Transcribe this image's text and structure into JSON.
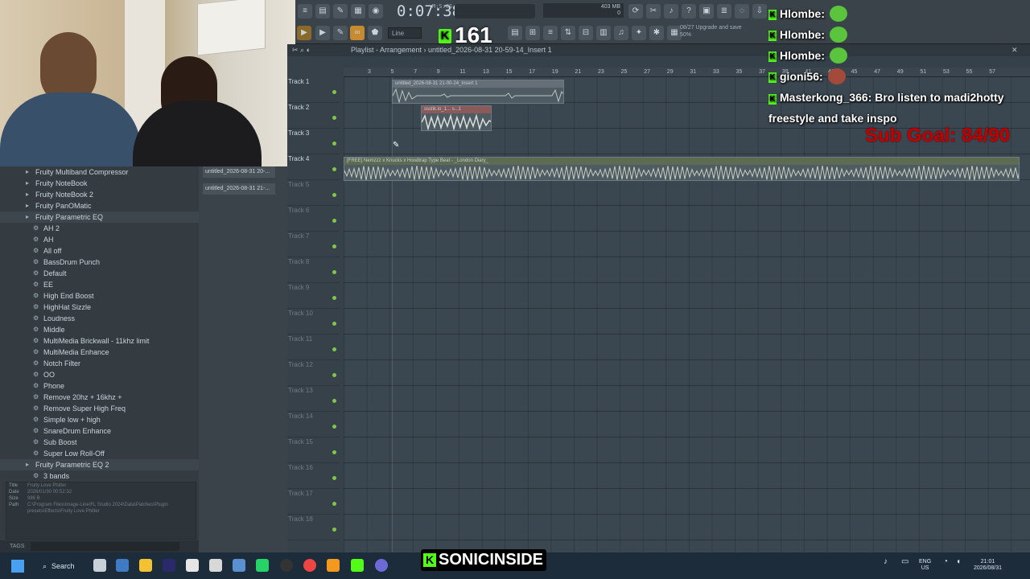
{
  "toolbar": {
    "time": "0:07:38",
    "time_unit": "M:S:CS",
    "memory": "403 MB",
    "memory_sub": "0",
    "snap": "Line",
    "pattern_label": "Pa",
    "upgrade_1": "08/27  Upgrade and save",
    "upgrade_2": "50%"
  },
  "kick_count": "161",
  "kick_k": "K",
  "browser": {
    "items": [
      {
        "type": "folder",
        "label": "Fruity Multiband Compressor"
      },
      {
        "type": "folder",
        "label": "Fruity NoteBook"
      },
      {
        "type": "folder",
        "label": "Fruity NoteBook 2"
      },
      {
        "type": "folder",
        "label": "Fruity PanOMatic"
      },
      {
        "type": "folder",
        "label": "Fruity Parametric EQ",
        "selected": true
      },
      {
        "type": "preset",
        "label": "AH 2"
      },
      {
        "type": "preset",
        "label": "AH"
      },
      {
        "type": "preset",
        "label": "All off"
      },
      {
        "type": "preset",
        "label": "BassDrum Punch"
      },
      {
        "type": "preset",
        "label": "Default"
      },
      {
        "type": "preset",
        "label": "EE"
      },
      {
        "type": "preset",
        "label": "High End Boost"
      },
      {
        "type": "preset",
        "label": "HighHat Sizzle"
      },
      {
        "type": "preset",
        "label": "Loudness"
      },
      {
        "type": "preset",
        "label": "Middle"
      },
      {
        "type": "preset",
        "label": "MultiMedia Brickwall - 11khz limit"
      },
      {
        "type": "preset",
        "label": "MultiMedia Enhance"
      },
      {
        "type": "preset",
        "label": "Notch Filter"
      },
      {
        "type": "preset",
        "label": "OO"
      },
      {
        "type": "preset",
        "label": "Phone"
      },
      {
        "type": "preset",
        "label": "Remove 20hz + 16khz +"
      },
      {
        "type": "preset",
        "label": "Remove Super High Freq"
      },
      {
        "type": "preset",
        "label": "Simple low + high"
      },
      {
        "type": "preset",
        "label": "SnareDrum Enhance"
      },
      {
        "type": "preset",
        "label": "Sub Boost"
      },
      {
        "type": "preset",
        "label": "Super Low Roll-Off"
      },
      {
        "type": "folder",
        "label": "Fruity Parametric EQ 2",
        "selected": true
      },
      {
        "type": "preset",
        "label": "3 bands"
      }
    ],
    "info": {
      "title_k": "Title",
      "title_v": "Fruity Love Philter",
      "date_k": "Date",
      "date_v": "2026/01/30 00:52:32",
      "size_k": "Size",
      "size_v": "986 B",
      "path_k": "Path",
      "path_v": "C:\\Program Files\\Image-Line\\FL Studio 2024\\Data\\Patches\\Plugin presets\\Effects\\Fruity Love Philter"
    },
    "tags_label": "TAGS"
  },
  "picker": {
    "items": [
      "untitled_2026-08-31 20-...",
      "untitled_2026-08-31 21-..."
    ]
  },
  "playlist": {
    "title": "Playlist - Arrangement",
    "path": "untitled_2026-08-31 20-59-14_Insert 1",
    "tracks": [
      "Track 1",
      "Track 2",
      "Track 3",
      "Track 4",
      "Track 5",
      "Track 6",
      "Track 7",
      "Track 8",
      "Track 9",
      "Track 10",
      "Track 11",
      "Track 12",
      "Track 13",
      "Track 14",
      "Track 15",
      "Track 16",
      "Track 17",
      "Track 18"
    ],
    "ruler": [
      "3",
      "5",
      "7",
      "9",
      "11",
      "13",
      "15",
      "17",
      "19",
      "21",
      "23",
      "25",
      "27",
      "29",
      "31",
      "33",
      "35",
      "37",
      "39",
      "41",
      "43",
      "45",
      "47",
      "49",
      "51",
      "53",
      "55",
      "57"
    ],
    "clips": {
      "clip1": "untitled_2026-08-31 21-00-24_Insert 1",
      "clip2": "ssstik.io_1...",
      "clip2b": "s...1",
      "clip4": "[FREE] Nemzzz x Knucks x Hoodtrap Type Beat - _London Diary_"
    }
  },
  "chat": [
    {
      "user": "Hlombe:",
      "msg": ""
    },
    {
      "user": "Hlombe:",
      "msg": ""
    },
    {
      "user": "Hlombe:",
      "msg": ""
    },
    {
      "user": "gioni56:",
      "msg": ""
    },
    {
      "user": "Masterkong_366:",
      "msg": "Bro listen to madi2hotty freestyle and take inspo"
    }
  ],
  "sub_goal": "Sub Goal: 84/90",
  "taskbar": {
    "search": "Search",
    "lang": "ENG",
    "region": "US",
    "time": "21:01",
    "date": "2026/08/31",
    "badge": "SONICINSIDE"
  },
  "colors": {
    "kick_green": "#53fc18",
    "sub_goal_red": "#c20000",
    "daw_bg": "#3a4751"
  }
}
